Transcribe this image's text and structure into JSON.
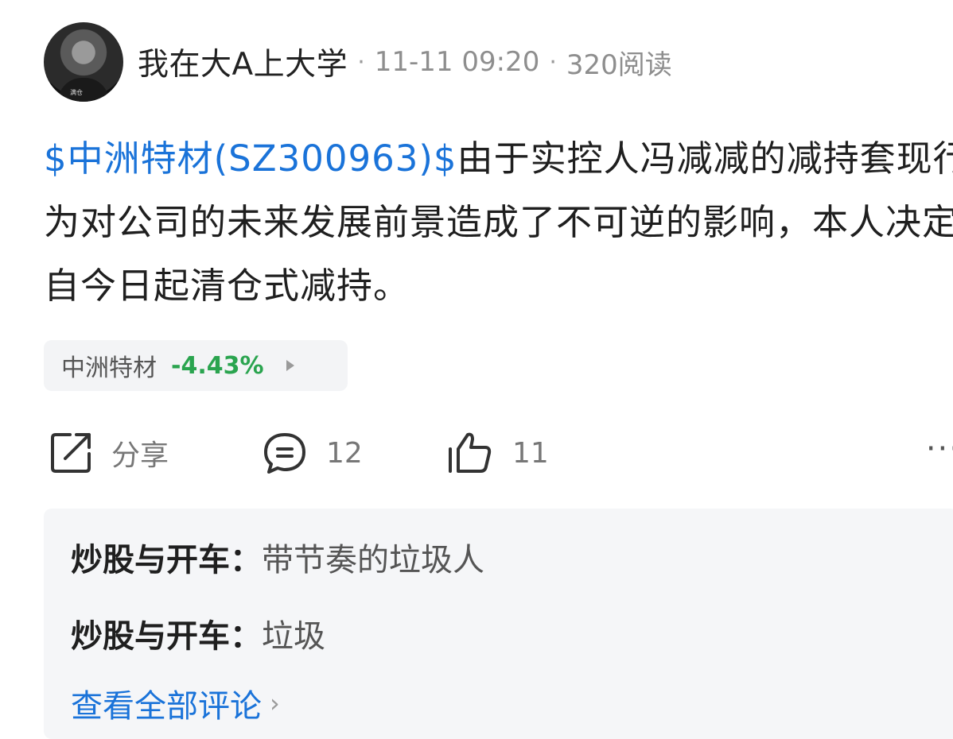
{
  "header": {
    "author": "我在大A上大学",
    "separator": "·",
    "timestamp": "11-11 09:20",
    "reads": "320阅读",
    "avatar_caption": "满仓"
  },
  "post": {
    "stock_link": "$中洲特材(SZ300963)$",
    "body": "由于实控人冯减减的减持套现行为对公司的未来发展前景造成了不可逆的影响，本人决定自今日起清仓式减持。"
  },
  "stock_chip": {
    "name": "中洲特材",
    "change": "-4.43%",
    "change_color": "#2aa44f"
  },
  "actions": {
    "share_label": "分享",
    "comment_count": "12",
    "like_count": "11",
    "more": "···"
  },
  "comments": [
    {
      "user": "炒股与开车",
      "colon": "：",
      "text": "带节奏的垃圾人"
    },
    {
      "user": "炒股与开车",
      "colon": "：",
      "text": "垃圾"
    }
  ],
  "view_all": {
    "label": "查看全部评论",
    "chevron": "›"
  },
  "colors": {
    "link": "#1a73d9",
    "down": "#2aa44f"
  }
}
